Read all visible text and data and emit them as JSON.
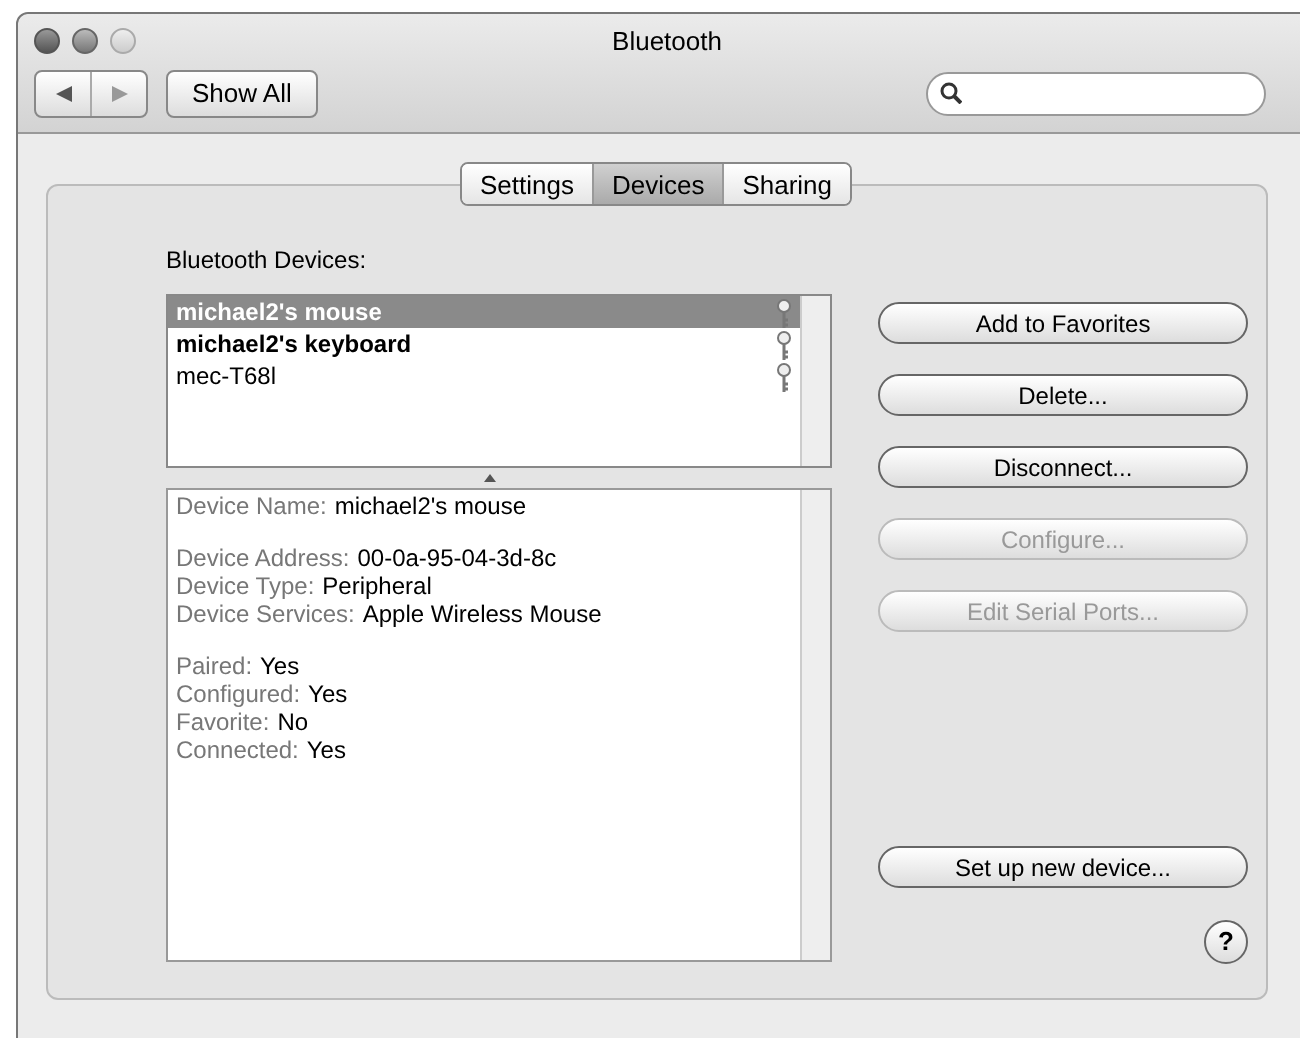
{
  "window": {
    "title": "Bluetooth"
  },
  "toolbar": {
    "show_all": "Show All"
  },
  "tabs": [
    {
      "label": "Settings",
      "selected": false
    },
    {
      "label": "Devices",
      "selected": true
    },
    {
      "label": "Sharing",
      "selected": false
    }
  ],
  "devices_label": "Bluetooth Devices:",
  "devices": [
    {
      "name": "michael2's mouse",
      "selected": true,
      "connected": true
    },
    {
      "name": "michael2's keyboard",
      "selected": false,
      "connected": true
    },
    {
      "name": "mec-T68l",
      "selected": false,
      "connected": false
    }
  ],
  "details": [
    [
      {
        "label": "Device Name:",
        "value": "michael2's mouse"
      }
    ],
    [
      {
        "label": "Device Address:",
        "value": "00-0a-95-04-3d-8c"
      },
      {
        "label": "Device Type:",
        "value": "Peripheral"
      },
      {
        "label": "Device Services:",
        "value": "Apple Wireless Mouse"
      }
    ],
    [
      {
        "label": "Paired:",
        "value": "Yes"
      },
      {
        "label": "Configured:",
        "value": "Yes"
      },
      {
        "label": "Favorite:",
        "value": "No"
      },
      {
        "label": "Connected:",
        "value": "Yes"
      }
    ]
  ],
  "buttons": [
    {
      "label": "Add to Favorites",
      "disabled": false
    },
    {
      "label": "Delete...",
      "disabled": false
    },
    {
      "label": "Disconnect...",
      "disabled": false
    },
    {
      "label": "Configure...",
      "disabled": true
    },
    {
      "label": "Edit Serial Ports...",
      "disabled": true
    }
  ],
  "setup_button": {
    "label": "Set up new device..."
  },
  "help": "?"
}
